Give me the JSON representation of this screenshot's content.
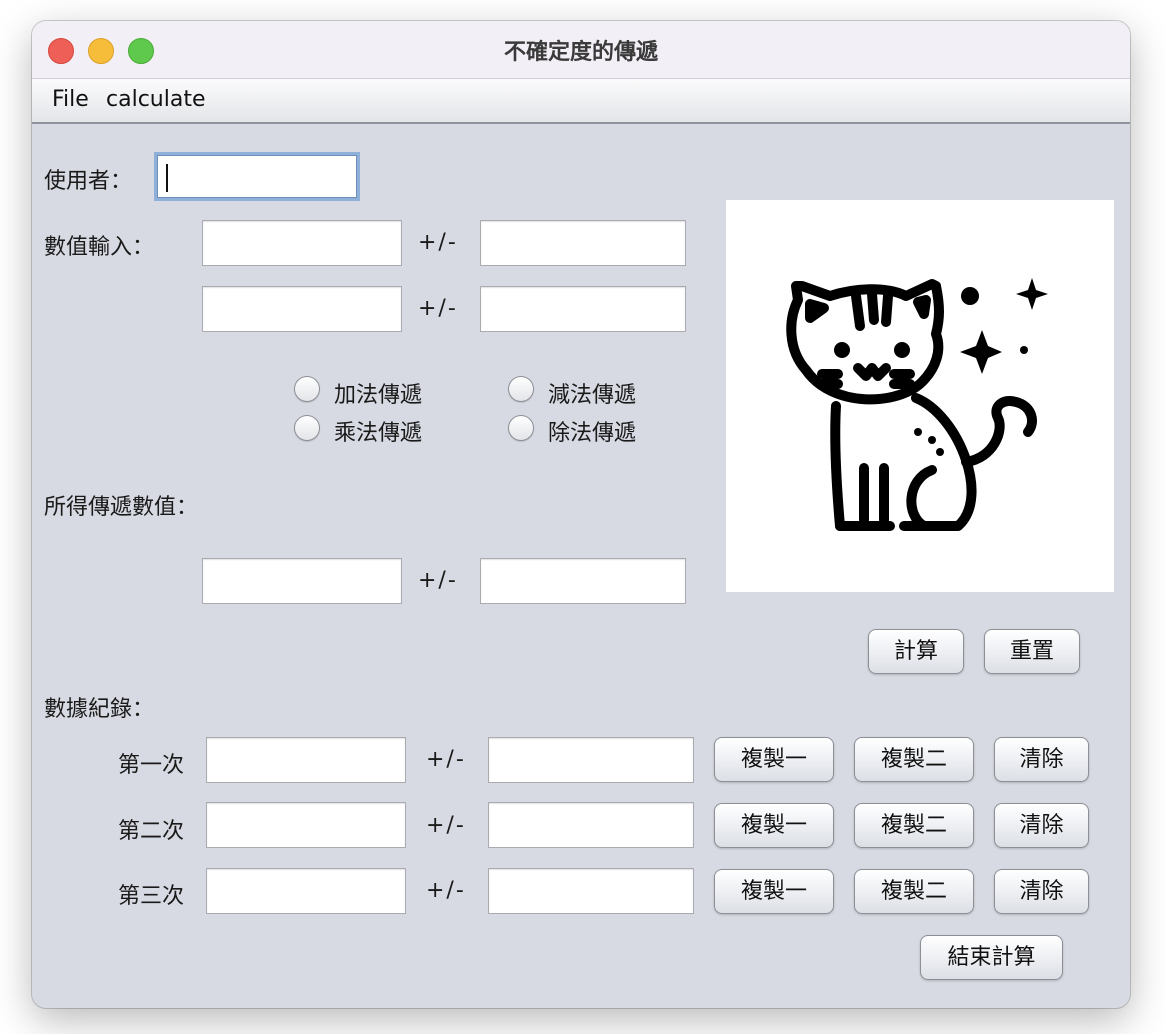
{
  "window": {
    "title": "不確定度的傳遞"
  },
  "menu": {
    "file": "File",
    "calculate": "calculate"
  },
  "user": {
    "label": "使用者：",
    "value": ""
  },
  "input": {
    "label": "數值輸入：",
    "pm": "+/-",
    "row1": {
      "value": "",
      "uncertainty": ""
    },
    "row2": {
      "value": "",
      "uncertainty": ""
    }
  },
  "operations": {
    "add": "加法傳遞",
    "subtract": "減法傳遞",
    "multiply": "乘法傳遞",
    "divide": "除法傳遞"
  },
  "result": {
    "label": "所得傳遞數值：",
    "value": "",
    "uncertainty": "",
    "pm": "+/-"
  },
  "image": {
    "name": "cat-sparkles"
  },
  "actions": {
    "calculate": "計算",
    "reset": "重置",
    "finish": "結束計算"
  },
  "records": {
    "label": "數據紀錄：",
    "pm": "+/-",
    "copy_one": "複製一",
    "copy_two": "複製二",
    "clear": "清除",
    "rows": [
      {
        "label": "第一次",
        "value": "",
        "uncertainty": ""
      },
      {
        "label": "第二次",
        "value": "",
        "uncertainty": ""
      },
      {
        "label": "第三次",
        "value": "",
        "uncertainty": ""
      }
    ]
  }
}
